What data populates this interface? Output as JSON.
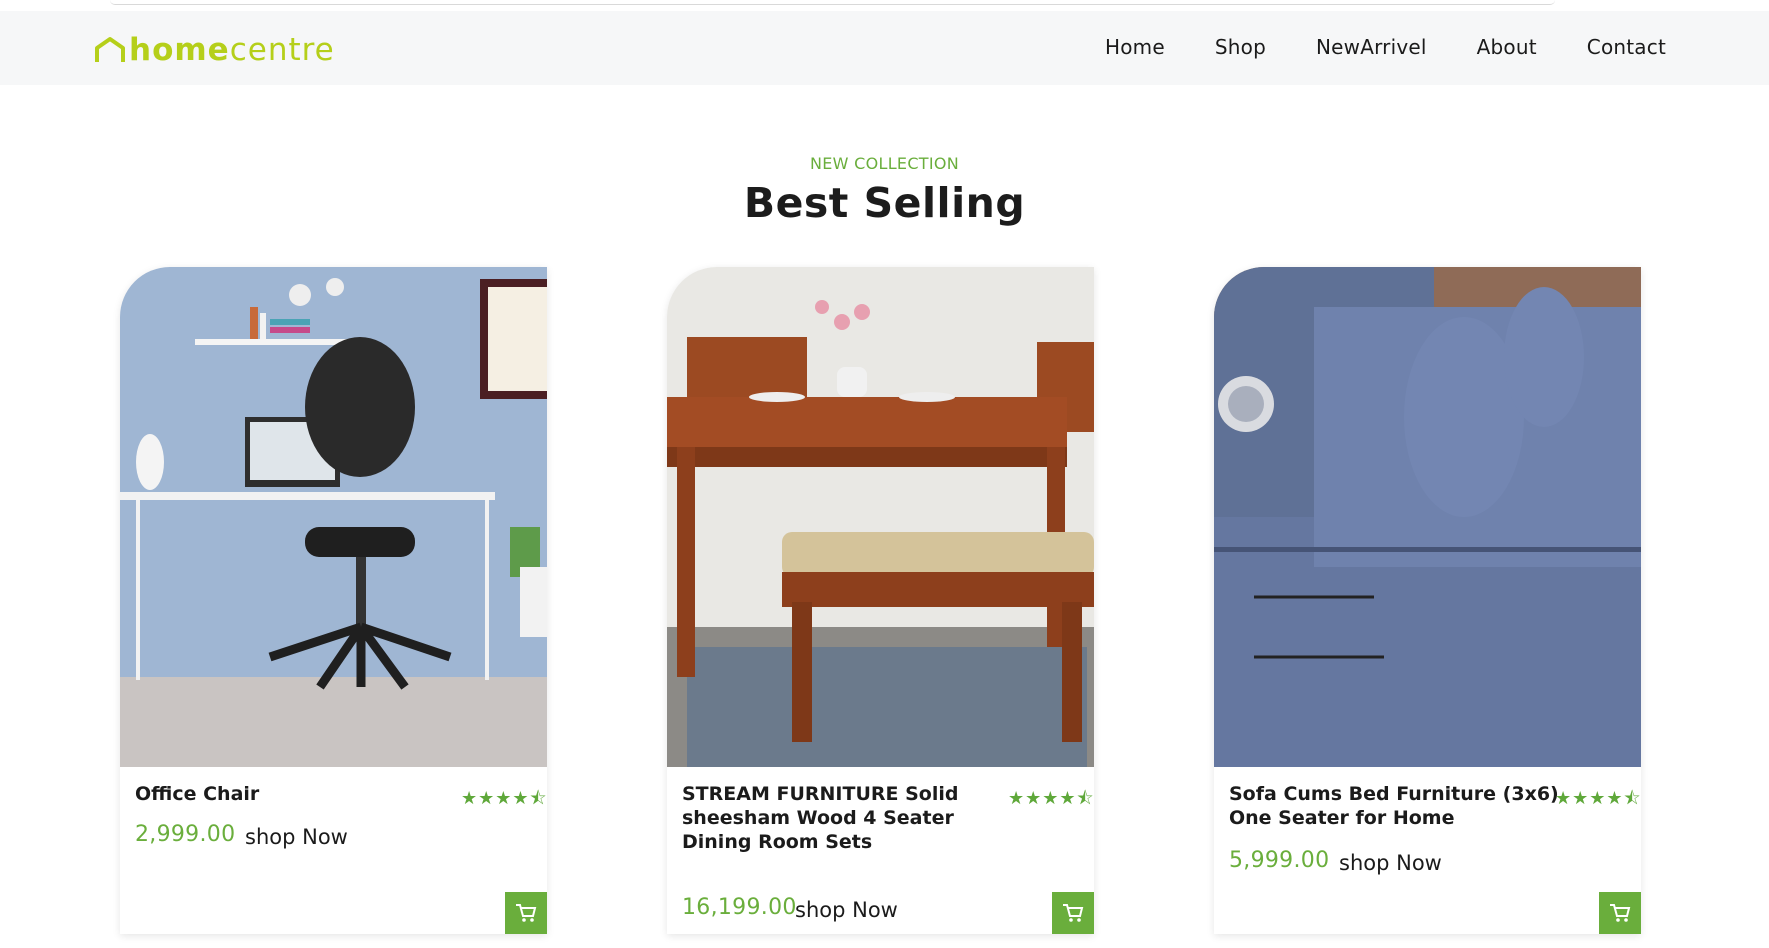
{
  "brand": {
    "name_part1": "home",
    "name_part2": "centre",
    "color": "#b5cf1a"
  },
  "nav": {
    "items": [
      "Home",
      "Shop",
      "NewArrivel",
      "About",
      "Contact"
    ]
  },
  "section": {
    "eyebrow": "NEW COLLECTION",
    "title": "Best Selling",
    "accent": "#6aae3c"
  },
  "products": [
    {
      "title": "Office Chair",
      "rating": 4.5,
      "stars": "★★★★⯪",
      "price": "2,999.00",
      "cta": "shop Now",
      "image_icon": "office-chair-image"
    },
    {
      "title": "STREAM FURNITURE Solid sheesham Wood 4 Seater Dining Room Sets",
      "rating": 4.5,
      "stars": "★★★★⯪",
      "price": "16,199.00",
      "cta": "shop Now",
      "image_icon": "dining-set-image"
    },
    {
      "title": "Sofa Cums Bed Furniture (3x6) One Seater for Home",
      "rating": 4.5,
      "stars": "★★★★⯪",
      "price": "5,999.00",
      "cta": "shop Now",
      "image_icon": "sofa-bed-image"
    }
  ],
  "icons": {
    "cart": "cart-icon",
    "logo": "house-logo-icon"
  }
}
